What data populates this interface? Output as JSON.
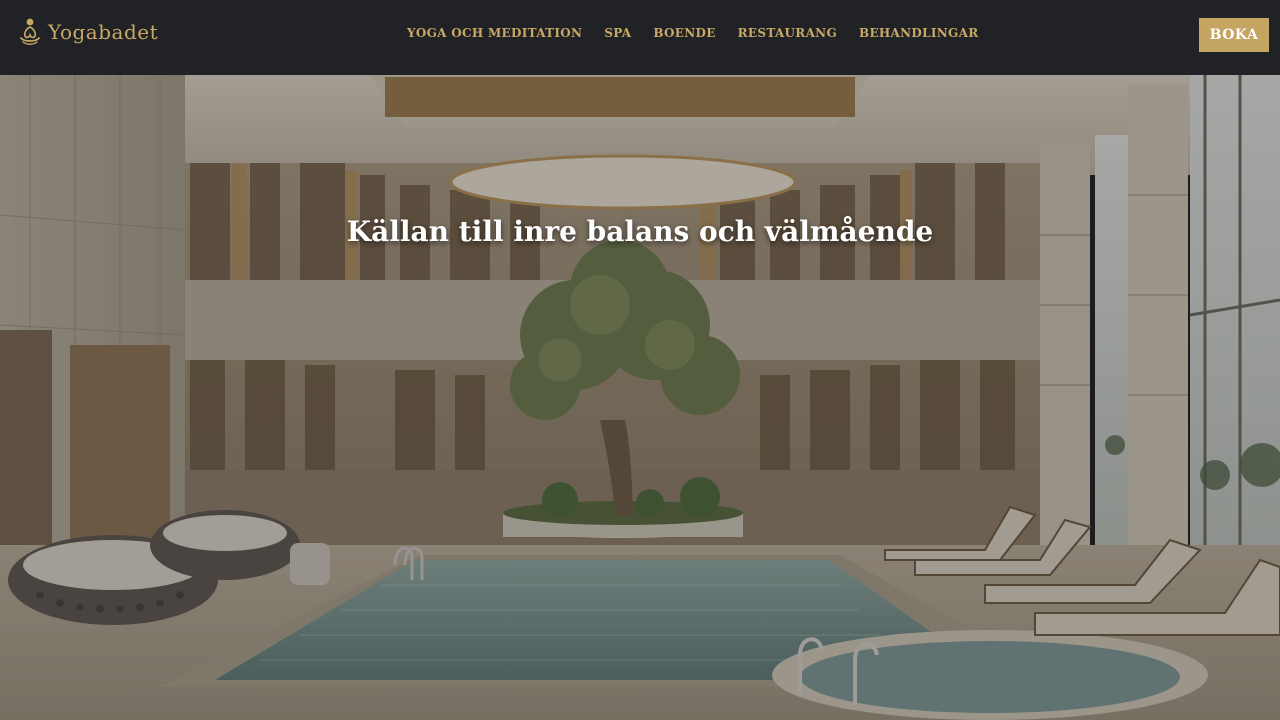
{
  "brand": {
    "name": "Yogabadet"
  },
  "nav": {
    "items": [
      {
        "label": "YOGA OCH MEDITATION"
      },
      {
        "label": "SPA"
      },
      {
        "label": "BOENDE"
      },
      {
        "label": "RESTAURANG"
      },
      {
        "label": "BEHANDLINGAR"
      }
    ]
  },
  "header": {
    "book_label": "BOKA"
  },
  "hero": {
    "title": "Källan till inre balans och välmående"
  },
  "colors": {
    "header_bg": "#202226",
    "accent_gold": "#c8a865",
    "button_bg": "#c4a562"
  }
}
